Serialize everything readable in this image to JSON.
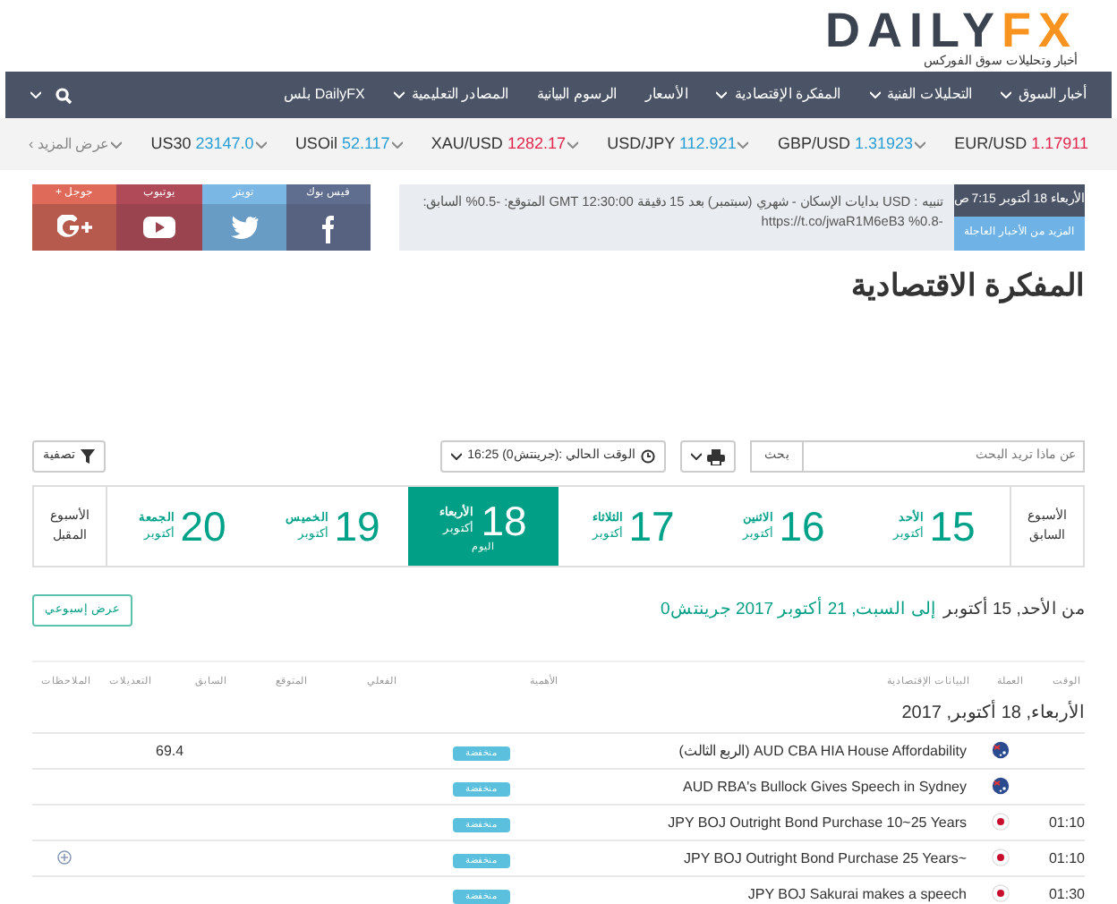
{
  "logo": {
    "text_1": "DAILY",
    "text_2": "FX",
    "tagline": "أخبار وتحليلات سوق الفوركس"
  },
  "nav": {
    "items": [
      {
        "label": "أخبار السوق",
        "dropdown": true
      },
      {
        "label": "التحليلات الفنية",
        "dropdown": true
      },
      {
        "label": "المفكرة الإقتصادية",
        "dropdown": true
      },
      {
        "label": "الأسعار",
        "dropdown": false
      },
      {
        "label": "الرسوم البيانية",
        "dropdown": false
      },
      {
        "label": "المصادر التعليمية",
        "dropdown": true
      },
      {
        "label": "DailyFX بلس",
        "dropdown": false
      }
    ]
  },
  "ticker": {
    "items": [
      {
        "symbol": "EUR/USD",
        "price": "1.17911",
        "color": "#e2264d"
      },
      {
        "symbol": "GBP/USD",
        "price": "1.31923",
        "color": "#2a9fd6"
      },
      {
        "symbol": "USD/JPY",
        "price": "112.921",
        "color": "#2a9fd6"
      },
      {
        "symbol": "XAU/USD",
        "price": "1282.17",
        "color": "#e2264d"
      },
      {
        "symbol": "USOil",
        "price": "52.117",
        "color": "#2a9fd6"
      },
      {
        "symbol": "US30",
        "price": "23147.0",
        "color": "#2a9fd6"
      }
    ],
    "more": "عرض المزيد ›"
  },
  "breaking_news": {
    "date": "الأربعاء 18 أكتوبر 7:15 ص",
    "more_link": "المزيد من الأخبار العاجلة",
    "text": "تنبيه : USD بدايات الإسكان - شهري (سبتمبر) بعد 15 دقيقة GMT 12:30:00 المتوقع: -0.5% السابق: -0.8% https://t.co/jwaR1M6eB3"
  },
  "social": [
    {
      "label": "فيس بوك",
      "kind": "facebook"
    },
    {
      "label": "تويتر",
      "kind": "twitter"
    },
    {
      "label": "يوتيوب",
      "kind": "youtube"
    },
    {
      "label": "جوجل +",
      "kind": "googleplus"
    }
  ],
  "page_title": "المفكرة الاقتصادية",
  "toolbar": {
    "search_placeholder": "عن ماذا تريد البحث",
    "search_button": "بحث",
    "time": "الوقت الحالي :(جرينتش0) 16:25",
    "filter": "تصفية"
  },
  "week": {
    "previous": "الأسبوع السابق",
    "next": "الأسبوع المقبل",
    "days": [
      {
        "number": "15",
        "name": "الأحد",
        "month": "أكتوبر",
        "selected": false
      },
      {
        "number": "16",
        "name": "الاثنين",
        "month": "أكتوبر",
        "selected": false
      },
      {
        "number": "17",
        "name": "الثلاثاء",
        "month": "أكتوبر",
        "selected": false
      },
      {
        "number": "18",
        "name": "الأربعاء",
        "month": "أكتوبر",
        "selected": true,
        "note": "اليوم"
      },
      {
        "number": "19",
        "name": "الخميس",
        "month": "أكتوبر",
        "selected": false
      },
      {
        "number": "20",
        "name": "الجمعة",
        "month": "أكتوبر",
        "selected": false
      }
    ]
  },
  "date_range": {
    "start": "من الأحد, 15 أكتوبر",
    "end": "إلى السبت, 21 أكتوبر 2017 جرينتش0"
  },
  "weekly_view_button": "عرض إسبوعي",
  "table": {
    "columns": [
      "الوقت",
      "العملة",
      "البيانات الإقتصادية",
      "الأهمية",
      "الفعلي",
      "المتوقع",
      "السابق",
      "التعديلات",
      "الملاحظات"
    ],
    "day_heading": "الأربعاء, 18 أكتوبر, 2017",
    "rows": [
      {
        "time": "",
        "kind": "au",
        "event": "AUD CBA HIA House Affordability (الربع الثالث)",
        "importance": "منخفضة",
        "previous": "69.4",
        "expandable": false
      },
      {
        "time": "",
        "kind": "au",
        "event": "AUD RBA's Bullock Gives Speech in Sydney",
        "importance": "منخفضة",
        "expandable": false
      },
      {
        "time": "01:10",
        "kind": "jp",
        "event": "JPY BOJ Outright Bond Purchase 10~25 Years",
        "importance": "منخفضة",
        "expandable": false
      },
      {
        "time": "01:10",
        "kind": "jp",
        "event": "~JPY BOJ Outright Bond Purchase 25 Years",
        "importance": "منخفضة",
        "expandable": true
      },
      {
        "time": "01:30",
        "kind": "jp",
        "event": "JPY BOJ Sakurai makes a speech",
        "importance": "منخفضة",
        "expandable": false
      }
    ]
  }
}
